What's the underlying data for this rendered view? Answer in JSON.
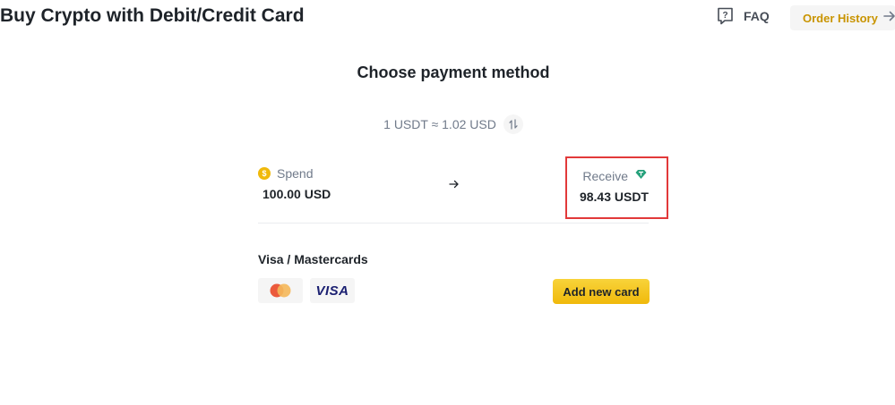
{
  "header": {
    "title": "Buy Crypto with Debit/Credit Card",
    "faq_label": "FAQ",
    "faq_icon": "question-doc-icon",
    "order_history_label": "Order History",
    "order_history_icon": "arrow-right-icon"
  },
  "payment": {
    "section_title": "Choose payment method",
    "rate_text": "1 USDT ≈ 1.02 USD",
    "rate_icon": "swap-vertical-icon",
    "spend": {
      "coin_symbol": "$",
      "label": "Spend",
      "value": "100.00 USD"
    },
    "receive": {
      "label": "Receive",
      "icon": "tether-diamond-icon",
      "value": "98.43 USDT"
    },
    "cards": {
      "title": "Visa / Mastercards",
      "visa_label": "VISA",
      "add_button_label": "Add new card"
    }
  },
  "colors": {
    "accent": "#f0b90b",
    "accent_text": "#c99400",
    "highlight_border": "#e2393a",
    "tether_green": "#26a17b"
  }
}
